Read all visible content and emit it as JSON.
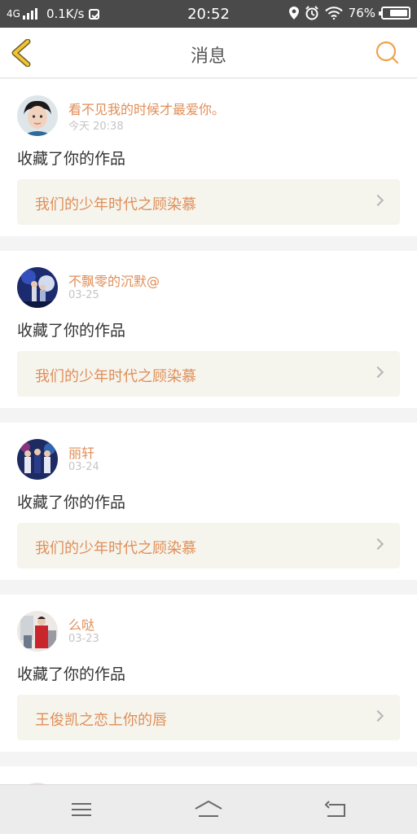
{
  "status_bar": {
    "network": "4G",
    "speed": "0.1K/s",
    "time": "20:52",
    "battery": "76%",
    "battery_level": 0.76,
    "icons": [
      "signal-icon",
      "message-icon",
      "location-icon",
      "alarm-icon",
      "wifi-icon",
      "battery-icon"
    ]
  },
  "header": {
    "title": "消息",
    "back_icon": "chevron-left-icon",
    "search_icon": "search-icon",
    "accent": "#f0a24a"
  },
  "messages": [
    {
      "name": "看不见我的时候才最爱你。",
      "time": "今天 20:38",
      "action": "收藏了你的作品",
      "work": "我们的少年时代之顾染慕"
    },
    {
      "name": "不飘零的沉默@",
      "time": "03-25",
      "action": "收藏了你的作品",
      "work": "我们的少年时代之顾染慕"
    },
    {
      "name": "丽轩",
      "time": "03-24",
      "action": "收藏了你的作品",
      "work": "我们的少年时代之顾染慕"
    },
    {
      "name": "么哒",
      "time": "03-23",
      "action": "收藏了你的作品",
      "work": "王俊凯之恋上你的唇"
    }
  ],
  "colors": {
    "name": "#e08e58",
    "work_bg": "#f5f5ee",
    "status_bar_bg": "#4a4a4a"
  },
  "nav": {
    "icons": [
      "menu-icon",
      "home-icon",
      "back-icon"
    ]
  }
}
